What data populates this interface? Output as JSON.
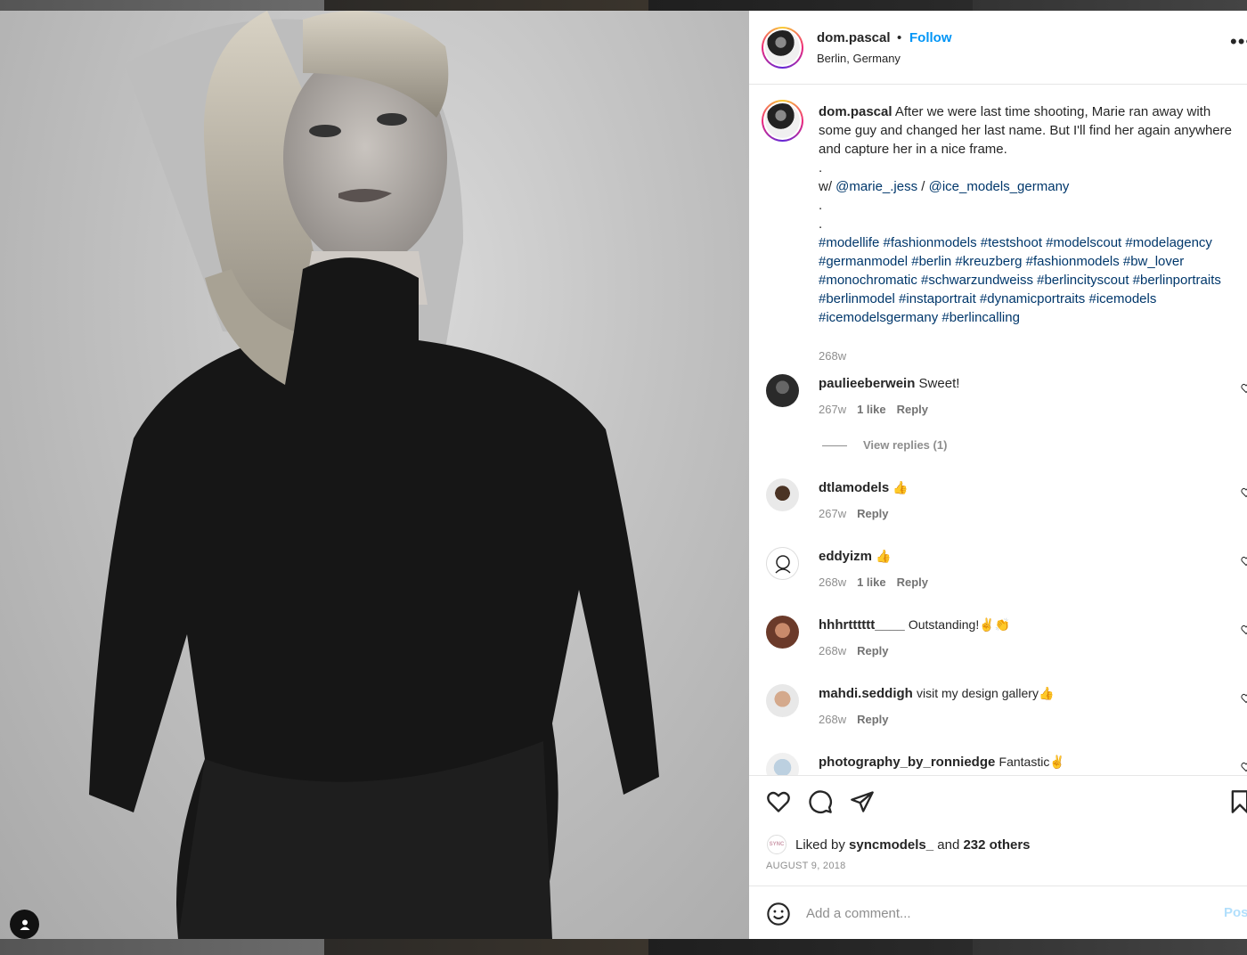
{
  "post": {
    "username": "dom.pascal",
    "dot": "•",
    "follow_label": "Follow",
    "location": "Berlin, Germany",
    "more_label": "•••"
  },
  "caption": {
    "username": "dom.pascal",
    "line1": "After we were last time shooting, Marie ran away with some guy and changed her last name. But I'll find her again anywhere and capture her in a nice frame.",
    "dot1": ".",
    "with_prefix": "w/",
    "mention1": "@marie_.jess",
    "slash": "/",
    "mention2": "@ice_models_germany",
    "dot2": ".",
    "dot3": ".",
    "hashtags": "#modellife #fashionmodels #testshoot #modelscout #modelagency #germanmodel #berlin #kreuzberg #fashionmodels #bw_lover #monochromatic #schwarzundweiss #berlincityscout #berlinportraits #berlinmodel #instaportrait #dynamicportraits #icemodels #icemodelsgermany #berlincalling",
    "time": "268w"
  },
  "comments": [
    {
      "username": "paulieeberwein",
      "text": "Sweet!",
      "time": "267w",
      "likes": "1 like",
      "reply": "Reply"
    },
    {
      "username": "dtlamodels",
      "text": "👍",
      "time": "267w",
      "likes": "",
      "reply": "Reply"
    },
    {
      "username": "eddyizm",
      "text": "👍",
      "time": "268w",
      "likes": "1 like",
      "reply": "Reply"
    },
    {
      "username": "hhhrtttttt____",
      "text": "Outstanding!✌👏",
      "time": "268w",
      "likes": "",
      "reply": "Reply"
    },
    {
      "username": "mahdi.seddigh",
      "text": "visit my design gallery👍",
      "time": "268w",
      "likes": "",
      "reply": "Reply"
    },
    {
      "username": "photography_by_ronniedge",
      "text": "Fantastic✌",
      "time": "",
      "likes": "",
      "reply": ""
    }
  ],
  "view_replies": "View replies (1)",
  "likes": {
    "prefix": "Liked by",
    "user": "syncmodels_",
    "and": "and",
    "others": "232 others",
    "avatar_text": "SYNC"
  },
  "date": "AUGUST 9, 2018",
  "add_comment": {
    "placeholder": "Add a comment...",
    "post_label": "Post"
  },
  "colors": {
    "link": "#00376b",
    "follow": "#0095f6",
    "muted": "#8e8e8e"
  }
}
